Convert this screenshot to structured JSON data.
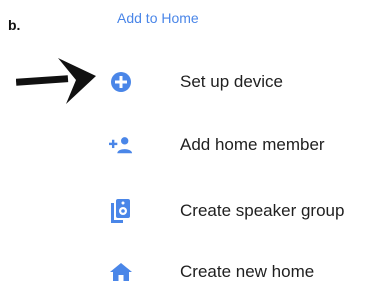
{
  "figure": {
    "panel_label": "b."
  },
  "screen": {
    "section_header": "Add to Home",
    "accent_color": "#4a86e8",
    "items": [
      {
        "label": "Set up device",
        "icon": "plus-circle-icon"
      },
      {
        "label": "Add home member",
        "icon": "add-person-icon"
      },
      {
        "label": "Create speaker group",
        "icon": "speaker-icon"
      },
      {
        "label": "Create new home",
        "icon": "home-icon"
      }
    ]
  },
  "annotation": {
    "pointer": "arrow-right-icon",
    "points_to": "Set up device"
  }
}
